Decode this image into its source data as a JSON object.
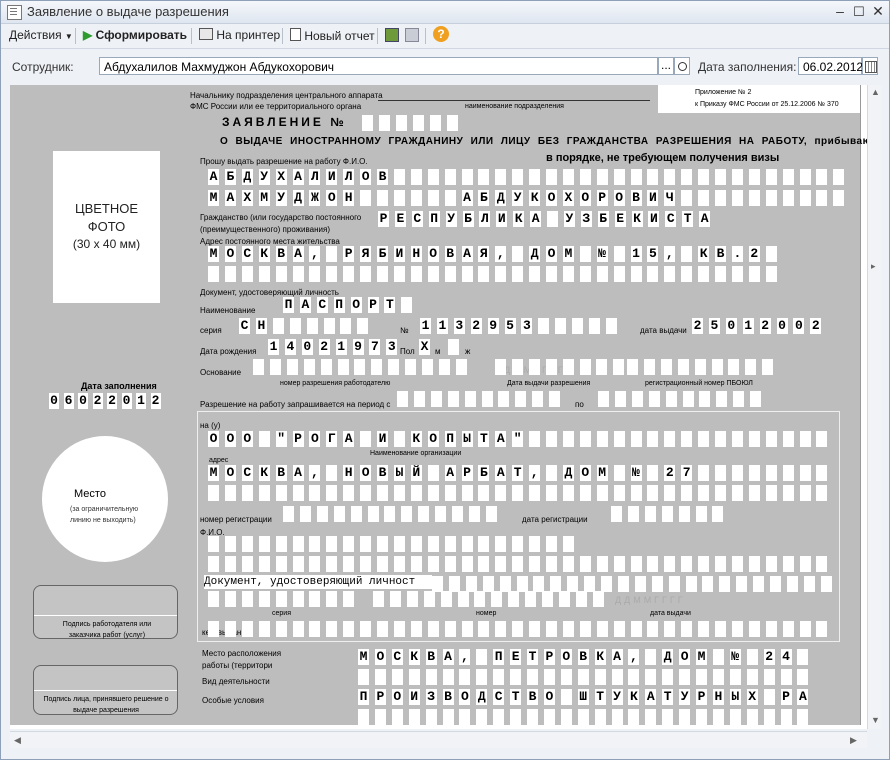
{
  "window": {
    "title": "Заявление о выдаче разрешения"
  },
  "toolbar": {
    "actions": "Действия",
    "generate": "Сформировать",
    "print": "На принтер",
    "new_report": "Новый отчет"
  },
  "header": {
    "employee_label": "Сотрудник:",
    "employee_value": "Абдухалилов Махмуджон Абдукохорович",
    "browse": "...",
    "date_label": "Дата заполнения:",
    "date_value": "06.02.2012"
  },
  "form": {
    "to_chief": "Начальнику подразделения центрального аппарата",
    "fms_text": "ФМС России или ее территориального органа",
    "dept_caption": "наименование подразделения",
    "annex1": "Приложение № 2",
    "annex2": "к Приказу ФМС России от 25.12.2006 № 370",
    "title": "ЗАЯВЛЕНИЕ №",
    "subtitle": "О ВЫДАЧЕ ИНОСТРАННОМУ ГРАЖДАНИНУ ИЛИ ЛИЦУ БЕЗ ГРАЖДАНСТВА РАЗРЕШЕНИЯ НА РАБОТУ, прибывающему в Р",
    "subtitle2": "в порядке, не требующем получения визы",
    "photo1": "ЦВЕТНОЕ",
    "photo2": "ФОТО",
    "photo3": "(30 х 40 мм)",
    "fill_date_label": "Дата заполнения",
    "fill_date_digits": "06022012",
    "place": "Место",
    "place_note": "(за ограничительную линию не выходить)",
    "sig_employer": "Подпись работодателя или заказчика работ (услуг)",
    "sig_decision": "Подпись лица, принявшего решение о выдаче разрешения",
    "ask_label": "Прошу выдать разрешение на работу Ф.И.О.",
    "surname": "АБДУХАЛИЛОВ",
    "name": "МАХМУДЖОН",
    "patronymic": "АБДУКОХОРОВИЧ",
    "citizenship_label": "Гражданство (или государство постоянного",
    "citizenship_label2": "(преимущественного) проживания)",
    "citizenship": "РЕСПУБЛИКА УЗБЕКИСТАН",
    "address_label": "Адрес постоянного места жительства",
    "address": "МОСКВА, РЯБИНОВАЯ, ДОМ № 15, КВ.2",
    "doc_label": "Документ, удостоверяющий личность",
    "doc_name_label": "Наименование",
    "doc_name": "ПАСПОРТ",
    "series_label": "серия",
    "series": "СН",
    "number_label": "№",
    "number": "1132953",
    "issued_label": "дата выдачи",
    "issued": "25012002",
    "birth_label": "Дата рождения",
    "birth": "14021973",
    "sex_label": "Пол",
    "sex_mark": "Х",
    "sex_m": "м",
    "sex_f": "ж",
    "basis_label": "Основание",
    "ddmm": "ДДММГГГГ",
    "permit_no_caption": "номер разрешения работодателю",
    "permit_date_caption": "Дата выдачи разрешения",
    "reg_no_caption": "регистрационный номер ПБОЮЛ",
    "period_label": "Разрешение на работу запрашивается на период с",
    "period_to": "по",
    "at_label": "на (у)",
    "org": "ООО \"РОГА И КОПЫТА\"",
    "org_caption": "Наименование организации",
    "addr_small": "адрес",
    "org_address": "МОСКВА, НОВЫЙ АРБАТ, ДОМ № 27",
    "regnum_label": "номер регистрации",
    "regdate_label": "дата регистрации",
    "fio_label": "Ф.И.О.",
    "id_doc_text": "Документ, удостоверяющий личност",
    "series_caption": "серия",
    "number_caption": "номер",
    "issue_date_caption": "дата выдачи",
    "issued_by_label": "кем выдан",
    "work_place_label": "Место расположения",
    "work_place_label2": "работы (территори",
    "work_place": "МОСКВА, ПЕТРОВКА, ДОМ № 24",
    "activity_label": "Вид деятельности",
    "conditions_label": "Особые условия",
    "conditions": "ПРОИЗВОДСТВО ШТУКАТУРНЫХ РАБОТ"
  },
  "colors": {
    "form_bg": "#bdbdbd",
    "cell": "#ffffff",
    "accent_green": "#2e9b2e"
  }
}
